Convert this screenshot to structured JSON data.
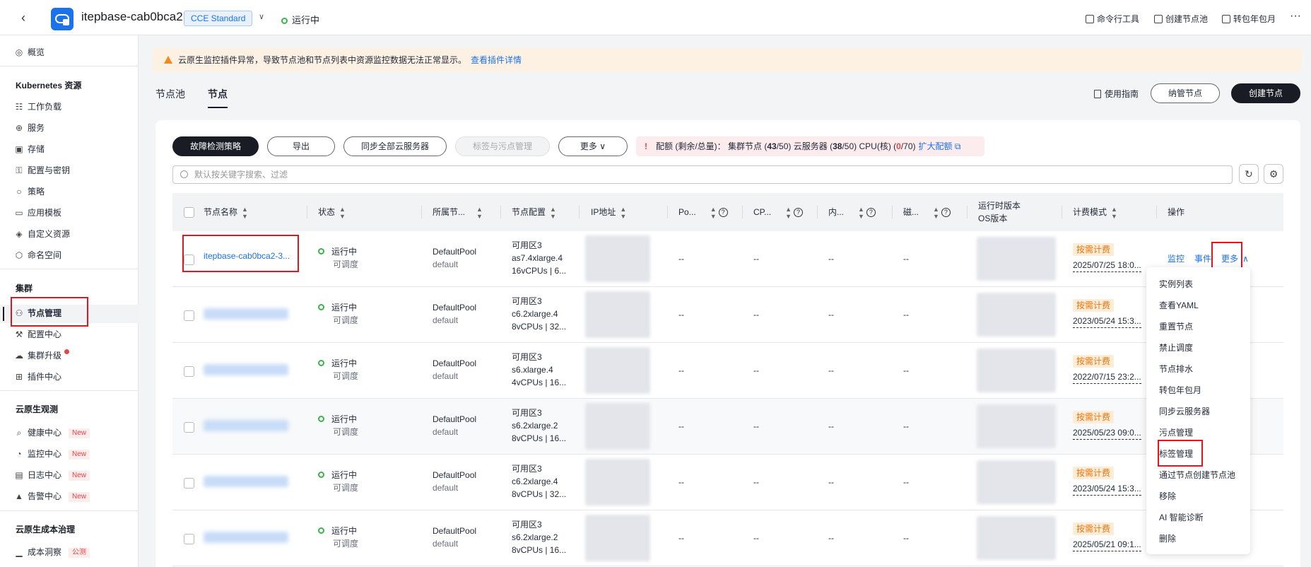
{
  "header": {
    "back_icon": "chevron-left-icon",
    "cluster_name": "itepbase-cab0bca2",
    "edition_badge": "CCE Standard",
    "status": "运行中",
    "tools": [
      "命令行工具",
      "创建节点池",
      "转包年包月"
    ],
    "more": "···"
  },
  "sidebar": {
    "overview": "概览",
    "groups": {
      "k8s": "Kubernetes 资源",
      "cluster": "集群",
      "observe": "云原生观测",
      "cost": "云原生成本治理"
    },
    "k8s_items": [
      "工作负载",
      "服务",
      "存储",
      "配置与密钥",
      "策略",
      "应用模板",
      "自定义资源",
      "命名空间"
    ],
    "cluster_items": [
      "节点管理",
      "配置中心",
      "集群升级",
      "插件中心"
    ],
    "observe_items": [
      "健康中心",
      "监控中心",
      "日志中心",
      "告警中心"
    ],
    "cost_items": [
      "成本洞察"
    ],
    "new_tag": "New",
    "beta_tag": "公测"
  },
  "alert": {
    "message": "云原生监控插件异常，导致节点池和节点列表中资源监控数据无法正常显示。",
    "link": "查看插件详情",
    "accent": "#f28a1b"
  },
  "tabs": [
    "节点池",
    "节点"
  ],
  "toolbar": {
    "guide": "使用指南",
    "manage_node": "纳管节点",
    "create_node": "创建节点",
    "fault_policy": "故障检测策略",
    "export": "导出",
    "sync": "同步全部云服务器",
    "label_taint": "标签与污点管理",
    "more": "更多"
  },
  "quota": {
    "prefix": "配额 (剩余/总量)：",
    "nodes_label": "集群节点 (",
    "nodes_used": "43",
    "nodes_total": "/50)",
    "ecs_label": "云服务器 (",
    "ecs_used": "38",
    "ecs_total": "/50)",
    "cpu_label": "CPU(核) (",
    "cpu_used": "0",
    "cpu_total": "/70)",
    "expand": "扩大配额"
  },
  "search": {
    "placeholder": "默认按关键字搜索、过滤"
  },
  "table": {
    "headers": {
      "name": "节点名称",
      "status": "状态",
      "pool": "所属节...",
      "config": "节点配置",
      "ip": "IP地址",
      "pod": "Po...",
      "cpu": "CP...",
      "mem": "内...",
      "disk": "磁...",
      "runtime_1": "运行时版本",
      "runtime_2": "OS版本",
      "billing": "计费模式",
      "ops": "操作"
    },
    "rows": [
      {
        "name": "itepbase-cab0bca2-3...",
        "status": "运行中",
        "sched": "可调度",
        "pool": "DefaultPool",
        "pool_sub": "default",
        "zone": "可用区3",
        "flavor": "as7.4xlarge.4",
        "spec": "16vCPUs | 6...",
        "pod": "--",
        "cpu": "--",
        "mem": "--",
        "disk": "--",
        "billing": "按需计费",
        "date": "2025/07/25 18:0..."
      },
      {
        "name": "",
        "status": "运行中",
        "sched": "可调度",
        "pool": "DefaultPool",
        "pool_sub": "default",
        "zone": "可用区3",
        "flavor": "c6.2xlarge.4",
        "spec": "8vCPUs | 32...",
        "pod": "--",
        "cpu": "--",
        "mem": "--",
        "disk": "--",
        "billing": "按需计费",
        "date": "2023/05/24 15:3..."
      },
      {
        "name": "",
        "status": "运行中",
        "sched": "可调度",
        "pool": "DefaultPool",
        "pool_sub": "default",
        "zone": "可用区3",
        "flavor": "s6.xlarge.4",
        "spec": "4vCPUs | 16...",
        "pod": "--",
        "cpu": "--",
        "mem": "--",
        "disk": "--",
        "billing": "按需计费",
        "date": "2022/07/15 23:2..."
      },
      {
        "name": "",
        "status": "运行中",
        "sched": "可调度",
        "pool": "DefaultPool",
        "pool_sub": "default",
        "zone": "可用区3",
        "flavor": "s6.2xlarge.2",
        "spec": "8vCPUs | 16...",
        "pod": "--",
        "cpu": "--",
        "mem": "--",
        "disk": "--",
        "billing": "按需计费",
        "date": "2025/05/23 09:0..."
      },
      {
        "name": "",
        "status": "运行中",
        "sched": "可调度",
        "pool": "DefaultPool",
        "pool_sub": "default",
        "zone": "可用区3",
        "flavor": "c6.2xlarge.4",
        "spec": "8vCPUs | 32...",
        "pod": "--",
        "cpu": "--",
        "mem": "--",
        "disk": "--",
        "billing": "按需计费",
        "date": "2023/05/24 15:3..."
      },
      {
        "name": "",
        "status": "运行中",
        "sched": "可调度",
        "pool": "DefaultPool",
        "pool_sub": "default",
        "zone": "可用区3",
        "flavor": "s6.2xlarge.2",
        "spec": "8vCPUs | 16...",
        "pod": "--",
        "cpu": "--",
        "mem": "--",
        "disk": "--",
        "billing": "按需计费",
        "date": "2025/05/21 09:1..."
      }
    ],
    "ops": {
      "monitor": "监控",
      "events": "事件",
      "more": "更多"
    }
  },
  "more_menu": [
    "实例列表",
    "查看YAML",
    "重置节点",
    "禁止调度",
    "节点排水",
    "转包年包月",
    "同步云服务器",
    "污点管理",
    "标签管理",
    "通过节点创建节点池",
    "移除",
    "AI 智能诊断",
    "删除"
  ],
  "colors": {
    "link": "#1a73e8",
    "highlight": "#e5141e",
    "running": "#3bb34a",
    "billing": "#e8760a"
  }
}
